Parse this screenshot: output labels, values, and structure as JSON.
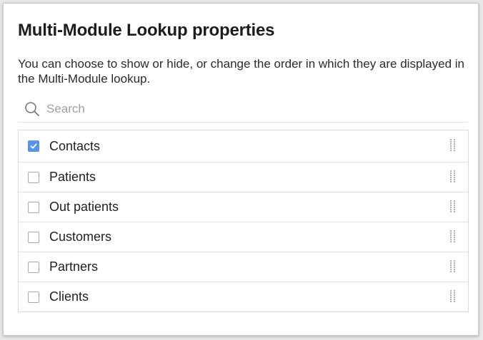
{
  "dialog": {
    "title": "Multi-Module Lookup properties",
    "description": "You can choose to show or hide, or change the order in which they are displayed in the Multi-Module lookup."
  },
  "search": {
    "placeholder": "Search",
    "value": "",
    "icon": "search-icon"
  },
  "modules": [
    {
      "label": "Contacts",
      "checked": true
    },
    {
      "label": "Patients",
      "checked": false
    },
    {
      "label": "Out patients",
      "checked": false
    },
    {
      "label": "Customers",
      "checked": false
    },
    {
      "label": "Partners",
      "checked": false
    },
    {
      "label": "Clients",
      "checked": false
    }
  ],
  "colors": {
    "accent": "#5b93e6",
    "border": "#d9d9d9"
  }
}
